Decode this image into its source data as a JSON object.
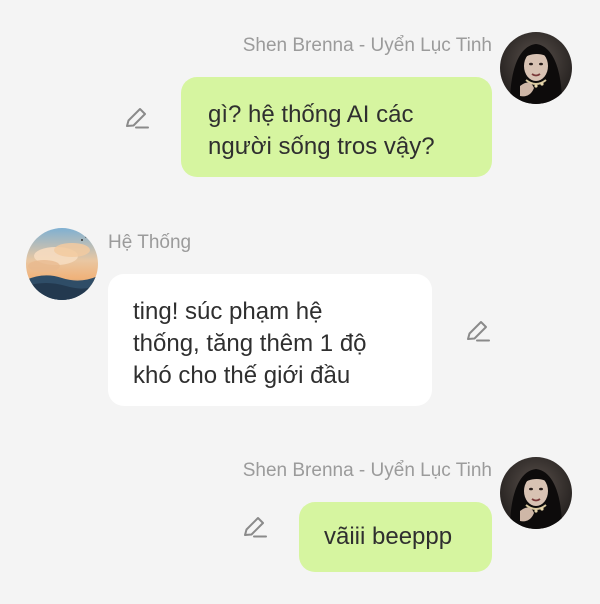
{
  "messages": [
    {
      "side": "right",
      "sender": "Shen Brenna - Uyển Lục Tinh",
      "avatar_icon": "girl-avatar-icon",
      "bubble_color": "#d6f5a0",
      "lines": [
        "gì? hệ thống AI các",
        "người sống tros vậy?"
      ]
    },
    {
      "side": "left",
      "sender": "Hệ Thống",
      "avatar_icon": "sunset-clouds-avatar-icon",
      "bubble_color": "#ffffff",
      "lines": [
        "ting! súc phạm hệ",
        "thống, tăng thêm 1 độ",
        "khó cho thế giới đầu"
      ]
    },
    {
      "side": "right",
      "sender": "Shen Brenna - Uyển Lục Tinh",
      "avatar_icon": "girl-avatar-icon",
      "bubble_color": "#d6f5a0",
      "lines": [
        "vãiii beeppp"
      ]
    }
  ],
  "colors": {
    "background": "#f4f4f4",
    "name_text": "#9b9b9b",
    "message_text": "#2f2f2f",
    "edit_icon": "#8a8a8a"
  },
  "icons": {
    "edit": "pencil-edit-icon"
  }
}
